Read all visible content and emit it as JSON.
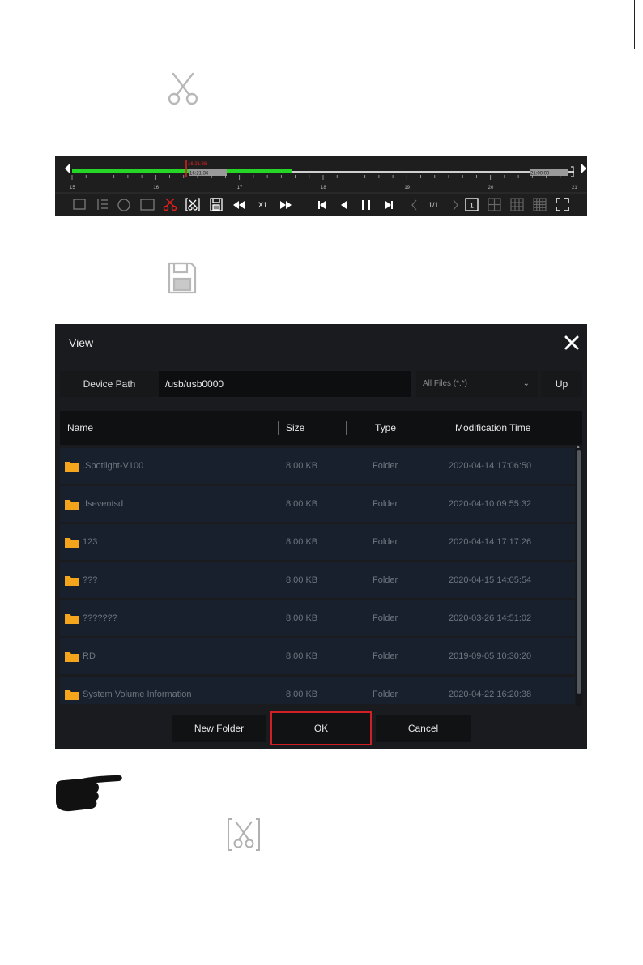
{
  "timeline": {
    "hour_labels": [
      "15",
      "16",
      "17",
      "18",
      "19",
      "20",
      "21"
    ],
    "clip_start_time": "16:21:36",
    "clip_end_time": "21:00:00",
    "cursor_time": "16:21:36",
    "speed_label": "X1",
    "page_label": "1/1",
    "layout_one_label": "1",
    "colors": {
      "recording": "#26d626",
      "cut": "#e02020"
    }
  },
  "dialog": {
    "title": "View",
    "device_path_label": "Device Path",
    "device_path_value": "/usb/usb0000",
    "file_filter": "All Files (*.*)",
    "up_label": "Up",
    "columns": {
      "name": "Name",
      "size": "Size",
      "type": "Type",
      "modified": "Modification Time"
    },
    "files": [
      {
        "name": ".Spotlight-V100",
        "size": "8.00 KB",
        "type": "Folder",
        "modified": "2020-04-14 17:06:50"
      },
      {
        "name": ".fseventsd",
        "size": "8.00 KB",
        "type": "Folder",
        "modified": "2020-04-10 09:55:32"
      },
      {
        "name": "123",
        "size": "8.00 KB",
        "type": "Folder",
        "modified": "2020-04-14 17:17:26"
      },
      {
        "name": "???",
        "size": "8.00 KB",
        "type": "Folder",
        "modified": "2020-04-15 14:05:54"
      },
      {
        "name": "???????",
        "size": "8.00 KB",
        "type": "Folder",
        "modified": "2020-03-26 14:51:02"
      },
      {
        "name": "RD",
        "size": "8.00 KB",
        "type": "Folder",
        "modified": "2019-09-05 10:30:20"
      },
      {
        "name": "System Volume Information",
        "size": "8.00 KB",
        "type": "Folder",
        "modified": "2020-04-22 16:20:38"
      }
    ],
    "buttons": {
      "new_folder": "New Folder",
      "ok": "OK",
      "cancel": "Cancel"
    },
    "colors": {
      "folder": "#f4a51c",
      "ok_border": "#d01f25"
    }
  },
  "icons": {
    "top_icon": "scissors-icon",
    "middle_icon": "save-icon",
    "note_icon": "pointing-hand-icon",
    "bottom_icon": "clip-scissors-icon"
  }
}
